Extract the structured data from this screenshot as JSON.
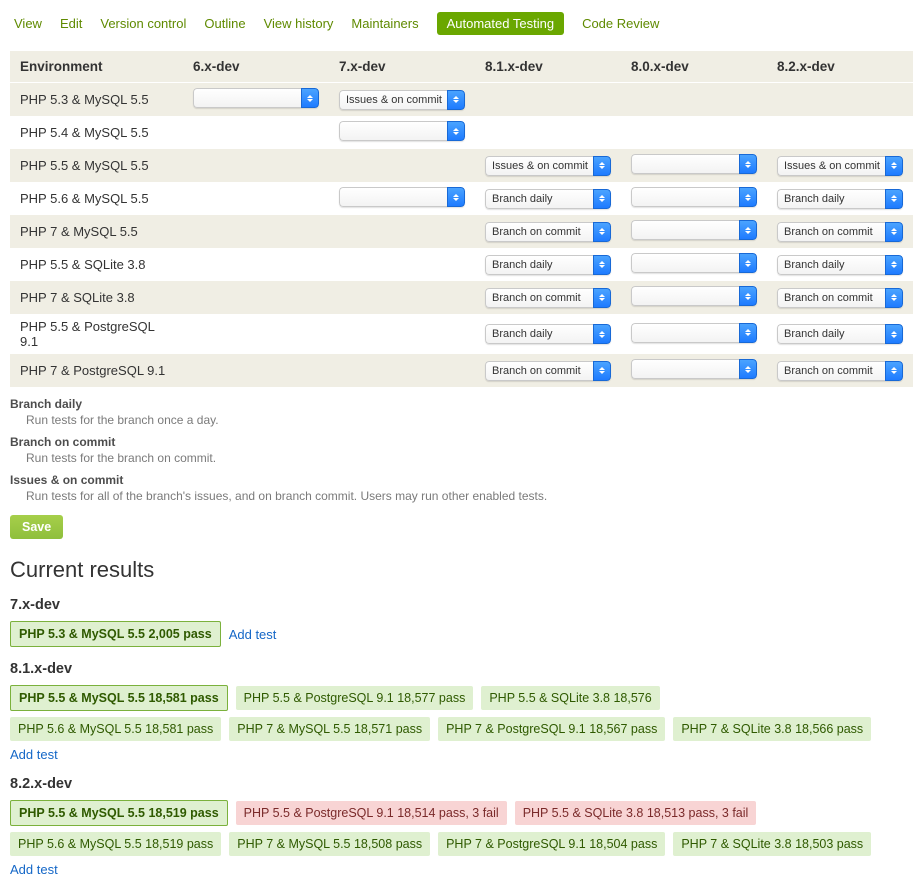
{
  "tabs": [
    "View",
    "Edit",
    "Version control",
    "Outline",
    "View history",
    "Maintainers",
    "Automated Testing",
    "Code Review"
  ],
  "active_tab": "Automated Testing",
  "headers": [
    "Environment",
    "6.x-dev",
    "7.x-dev",
    "8.1.x-dev",
    "8.0.x-dev",
    "8.2.x-dev"
  ],
  "environments": [
    {
      "name": "PHP 5.3 & MySQL 5.5",
      "cells": [
        "",
        "Issues & on commit",
        null,
        null,
        null
      ]
    },
    {
      "name": "PHP 5.4 & MySQL 5.5",
      "cells": [
        null,
        "",
        null,
        null,
        null
      ]
    },
    {
      "name": "PHP 5.5 & MySQL 5.5",
      "cells": [
        null,
        null,
        "Issues & on commit",
        "",
        "Issues & on commit"
      ]
    },
    {
      "name": "PHP 5.6 & MySQL 5.5",
      "cells": [
        null,
        "",
        "Branch daily",
        "",
        "Branch daily"
      ]
    },
    {
      "name": "PHP 7 & MySQL 5.5",
      "cells": [
        null,
        null,
        "Branch on commit",
        "",
        "Branch on commit"
      ]
    },
    {
      "name": "PHP 5.5 & SQLite 3.8",
      "cells": [
        null,
        null,
        "Branch daily",
        "",
        "Branch daily"
      ]
    },
    {
      "name": "PHP 7 & SQLite 3.8",
      "cells": [
        null,
        null,
        "Branch on commit",
        "",
        "Branch on commit"
      ]
    },
    {
      "name": "PHP 5.5 & PostgreSQL 9.1",
      "cells": [
        null,
        null,
        "Branch daily",
        "",
        "Branch daily"
      ]
    },
    {
      "name": "PHP 7 & PostgreSQL 9.1",
      "cells": [
        null,
        null,
        "Branch on commit",
        "",
        "Branch on commit"
      ]
    }
  ],
  "defs": [
    {
      "term": "Branch daily",
      "desc": "Run tests for the branch once a day."
    },
    {
      "term": "Branch on commit",
      "desc": "Run tests for the branch on commit."
    },
    {
      "term": "Issues & on commit",
      "desc": "Run tests for all of the branch's issues, and on branch commit. Users may run other enabled tests."
    }
  ],
  "save_label": "Save",
  "results_heading": "Current results",
  "add_test_label": "Add test",
  "results": [
    {
      "branch": "7.x-dev",
      "rows": [
        [
          {
            "text": "PHP 5.3 & MySQL 5.5 2,005 pass",
            "status": "pass",
            "strong": true
          },
          {
            "text": "Add test",
            "link": true
          }
        ]
      ]
    },
    {
      "branch": "8.1.x-dev",
      "rows": [
        [
          {
            "text": "PHP 5.5 & MySQL 5.5 18,581 pass",
            "status": "pass",
            "strong": true
          },
          {
            "text": "PHP 5.5 & PostgreSQL 9.1 18,577 pass",
            "status": "pass"
          },
          {
            "text": "PHP 5.5 & SQLite 3.8 18,576",
            "status": "pass"
          }
        ],
        [
          {
            "text": "PHP 5.6 & MySQL 5.5 18,581 pass",
            "status": "pass"
          },
          {
            "text": "PHP 7 & MySQL 5.5 18,571 pass",
            "status": "pass"
          },
          {
            "text": "PHP 7 & PostgreSQL 9.1 18,567 pass",
            "status": "pass"
          },
          {
            "text": "PHP 7 & SQLite 3.8 18,566 pass",
            "status": "pass"
          }
        ],
        [
          {
            "text": "Add test",
            "link": true
          }
        ]
      ]
    },
    {
      "branch": "8.2.x-dev",
      "rows": [
        [
          {
            "text": "PHP 5.5 & MySQL 5.5 18,519 pass",
            "status": "pass",
            "strong": true
          },
          {
            "text": "PHP 5.5 & PostgreSQL 9.1 18,514 pass, 3 fail",
            "status": "fail"
          },
          {
            "text": "PHP 5.5 & SQLite 3.8 18,513 pass, 3 fail",
            "status": "fail"
          }
        ],
        [
          {
            "text": "PHP 5.6 & MySQL 5.5 18,519 pass",
            "status": "pass"
          },
          {
            "text": "PHP 7 & MySQL 5.5 18,508 pass",
            "status": "pass"
          },
          {
            "text": "PHP 7 & PostgreSQL 9.1 18,504 pass",
            "status": "pass"
          },
          {
            "text": "PHP 7 & SQLite 3.8 18,503 pass",
            "status": "pass"
          }
        ],
        [
          {
            "text": "Add test",
            "link": true
          }
        ]
      ]
    }
  ]
}
